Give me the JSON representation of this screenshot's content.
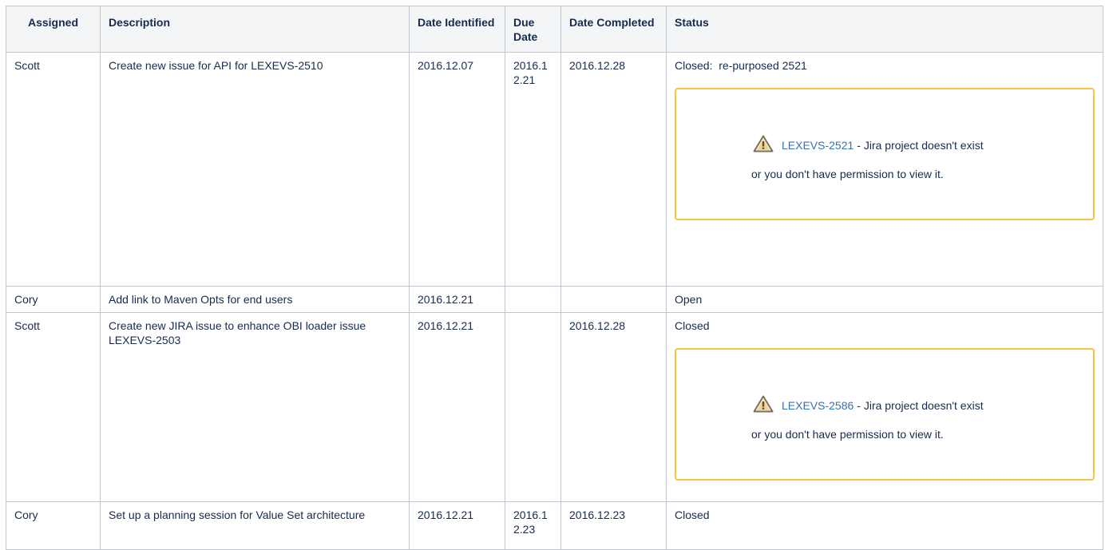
{
  "table": {
    "headers": {
      "assigned": "Assigned",
      "description": "Description",
      "date_identified": "Date Identified",
      "due_date": "Due Date",
      "date_completed": "Date Completed",
      "status": "Status"
    },
    "rows": [
      {
        "assigned": "Scott",
        "description": "Create new issue for API for LEXEVS-2510",
        "date_identified": "2016.12.07",
        "due_date": "2016.12.21",
        "date_completed": "2016.12.28",
        "status": "Closed:  re-purposed 2521",
        "jira": {
          "key": "LEXEVS-2521",
          "message_line1": "- Jira project doesn't exist",
          "message_line2": "or you don't have permission to view it."
        }
      },
      {
        "assigned": "Cory",
        "description": "Add link to Maven Opts for end users",
        "date_identified": "2016.12.21",
        "due_date": "",
        "date_completed": "",
        "status": "Open"
      },
      {
        "assigned": "Scott",
        "description": "Create new JIRA issue to enhance OBI loader issue LEXEVS-2503",
        "date_identified": "2016.12.21",
        "due_date": "",
        "date_completed": "2016.12.28",
        "status": "Closed",
        "jira": {
          "key": "LEXEVS-2586",
          "message_line1": "- Jira project doesn't exist",
          "message_line2": "or you don't have permission to view it."
        }
      },
      {
        "assigned": "Cory",
        "description": "Set up a planning session for Value Set architecture",
        "date_identified": "2016.12.21",
        "due_date": "2016.12.23",
        "date_completed": "2016.12.23",
        "status": "Closed"
      }
    ]
  },
  "icons": {
    "jira_warning": "warning-triangle-icon"
  },
  "colors": {
    "header_bg": "#f4f5f7",
    "border": "#c1c7d0",
    "panel_border": "#f6c342",
    "link": "#3572b0",
    "text": "#172b4d"
  }
}
